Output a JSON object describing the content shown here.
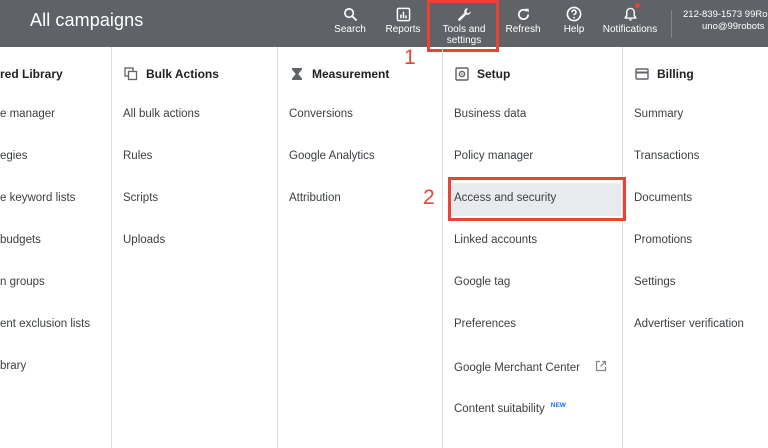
{
  "header": {
    "title": "All campaigns",
    "tools": [
      {
        "icon": "search-icon",
        "label": "Search"
      },
      {
        "icon": "reports-icon",
        "label": "Reports"
      },
      {
        "icon": "wrench-icon",
        "label_line1": "Tools and",
        "label_line2": "settings"
      },
      {
        "icon": "refresh-icon",
        "label": "Refresh"
      },
      {
        "icon": "help-icon",
        "label": "Help"
      },
      {
        "icon": "bell-icon",
        "label": "Notifications"
      }
    ],
    "account_id": "212-839-1573 99Ro",
    "account_email": "uno@99robots"
  },
  "annotations": {
    "step1": "1",
    "step2": "2",
    "color": "#ea4335"
  },
  "columns": [
    {
      "title": "red Library",
      "items": [
        "e manager",
        "egies",
        "e keyword lists",
        "budgets",
        "n groups",
        "ent exclusion lists",
        "brary"
      ]
    },
    {
      "title": "Bulk Actions",
      "icon": "bulk-actions-icon",
      "items": [
        "All bulk actions",
        "Rules",
        "Scripts",
        "Uploads"
      ]
    },
    {
      "title": "Measurement",
      "icon": "hourglass-icon",
      "items": [
        "Conversions",
        "Google Analytics",
        "Attribution"
      ]
    },
    {
      "title": "Setup",
      "icon": "setup-icon",
      "items": [
        "Business data",
        "Policy manager",
        "Access and security",
        "Linked accounts",
        "Google tag",
        "Preferences",
        "Google Merchant Center",
        "Content suitability"
      ],
      "new_badge": "NEW"
    },
    {
      "title": "Billing",
      "icon": "billing-icon",
      "items": [
        "Summary",
        "Transactions",
        "Documents",
        "Promotions",
        "Settings",
        "Advertiser verification"
      ]
    }
  ]
}
